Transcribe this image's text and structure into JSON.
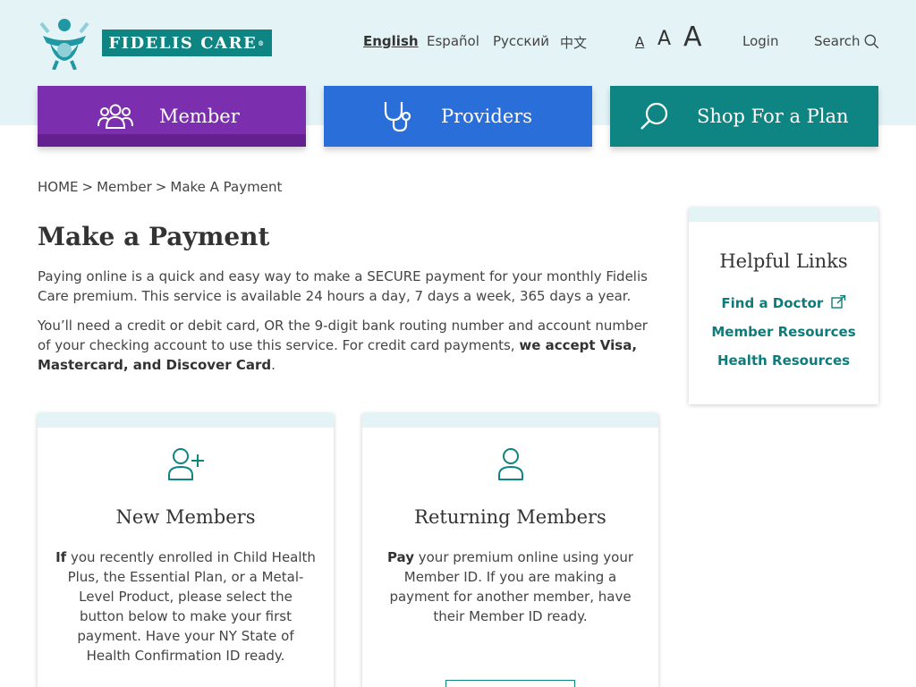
{
  "brand": {
    "name": "Fidelis Care",
    "mark": "®",
    "color": "#0e8583"
  },
  "languages": [
    {
      "label": "English",
      "active": true
    },
    {
      "label": "Español",
      "active": false
    },
    {
      "label": "Русский",
      "active": false
    },
    {
      "label": "中文",
      "active": false
    }
  ],
  "font_size_controls": [
    "A",
    "A",
    "A"
  ],
  "header": {
    "login": "Login",
    "search": "Search"
  },
  "nav_tiles": [
    {
      "label": "Member",
      "icon": "users-icon",
      "color": "#7b2fae"
    },
    {
      "label": "Providers",
      "icon": "stethoscope-icon",
      "color": "#2a6fd9"
    },
    {
      "label": "Shop For a Plan",
      "icon": "search-icon",
      "color": "#0e8583"
    }
  ],
  "breadcrumb": [
    "HOME",
    ">",
    "Member",
    ">",
    "Make A Payment"
  ],
  "page": {
    "title": "Make a Payment",
    "intro": "Paying online is a quick and easy way to make a SECURE payment for your monthly Fidelis Care premium. This service is available 24 hours a day, 7 days a week, 365 days a year.",
    "requirements_prefix": "You’ll need a credit or debit card, OR the 9-digit bank routing number and account number of your checking account to use this service. For credit card payments, ",
    "requirements_bold": "we accept Visa, Mastercard, and Discover Card",
    "requirements_suffix": "."
  },
  "helpful_links": {
    "title": "Helpful Links",
    "links": [
      "Find a Doctor",
      "Member Resources",
      "Health Resources"
    ]
  },
  "cards": [
    {
      "title": "New Members",
      "icon": "user-plus-icon",
      "lead": "If",
      "body": " you recently enrolled in Child Health Plus, the Essential Plan, or a Metal-Level Product, please select the button below to make your first payment. Have your NY State of Health Confirmation ID ready."
    },
    {
      "title": "Returning Members",
      "icon": "user-icon",
      "lead": "Pay",
      "body": " your premium online using your Member ID. If you are making a payment for another member, have their Member ID ready."
    }
  ]
}
